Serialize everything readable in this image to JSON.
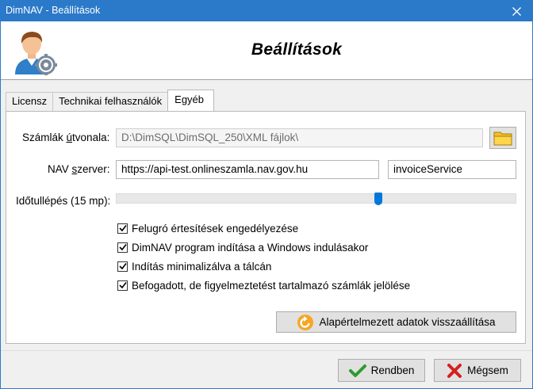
{
  "window": {
    "title": "DimNAV - Beállítások"
  },
  "header": {
    "heading": "Beállítások",
    "avatar_icon": "user-settings-icon"
  },
  "tabs": [
    {
      "label": "Licensz",
      "active": false
    },
    {
      "label": "Technikai felhasználók",
      "active": false
    },
    {
      "label": "Egyéb",
      "active": true
    }
  ],
  "form": {
    "invoice_path": {
      "label_pre": "Számlák ",
      "label_underlined": "ú",
      "label_post": "tvonala:",
      "value": "D:\\DimSQL\\DimSQL_250\\XML fájlok\\"
    },
    "nav_server": {
      "label_pre": "NAV ",
      "label_underlined": "s",
      "label_post": "zerver:",
      "url": "https://api-test.onlineszamla.nav.gov.hu",
      "service": "invoiceService"
    },
    "timeout": {
      "label": "Időtullépés (15 mp):",
      "level_fraction": 0.66
    },
    "checkboxes": [
      {
        "label": "Felugró értesítések engedélyezése",
        "checked": true
      },
      {
        "label": "DimNAV program indítása a Windows indulásakor",
        "checked": true
      },
      {
        "label": "Indítás minimalizálva a tálcán",
        "checked": true
      },
      {
        "label": "Befogadott, de figyelmeztetést tartalmazó számlák jelölése",
        "checked": true
      }
    ],
    "reset_button": "Alapértelmezett adatok visszaállítása"
  },
  "footer": {
    "ok_label": "Rendben",
    "cancel_label": "Mégsem"
  },
  "colors": {
    "titlebar": "#2b79c9",
    "accent": "#0078d7",
    "ok_green": "#2e9b2e",
    "cancel_red": "#d42020"
  }
}
